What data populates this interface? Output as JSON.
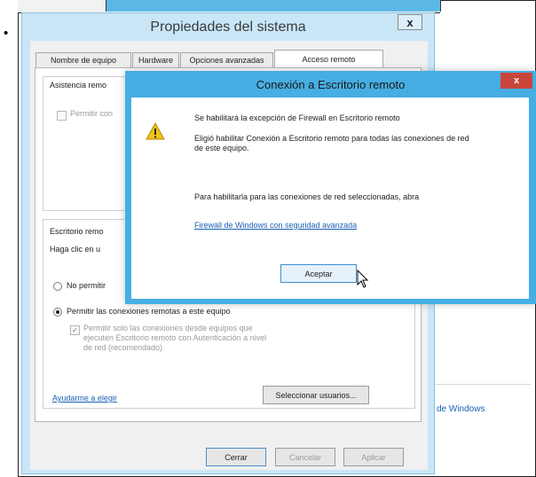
{
  "bullet": "•",
  "system_dialog": {
    "title": "Propiedades del sistema",
    "close": "x",
    "tabs": [
      {
        "label": "Nombre de equipo"
      },
      {
        "label": "Hardware"
      },
      {
        "label": "Opciones avanzadas"
      },
      {
        "label": "Acceso remoto",
        "active": true
      }
    ],
    "assistance_group": {
      "label": "Asistencia remo",
      "checkbox_label": "Permitir con",
      "checked": false
    },
    "remote_desktop_group": {
      "label": "Escritorio remo",
      "hint": "Haga clic en u",
      "options": [
        {
          "label": "No permitir",
          "selected": false
        },
        {
          "label": "Permitir las conexiones remotas a este equipo",
          "selected": true
        }
      ],
      "nla_label": "Permitir solo las conexiones desde equipos que ejecuten Escritorio remoto con Autenticación a nivel de red (recomendado)",
      "nla_checked": true
    },
    "help_link": "Ayudarme a elegir",
    "select_users_button": "Seleccionar usuarios...",
    "buttons": {
      "close": "Cerrar",
      "cancel": "Cancelar",
      "apply": "Aplicar"
    }
  },
  "popup": {
    "title": "Conexión a Escritorio remoto",
    "close": "x",
    "message1": "Se habilitará la excepción de Firewall en Escritorio remoto",
    "message2": "Eligió habilitar Conexión a Escritorio remoto para todas las conexiones de red de este equipo.",
    "message3": "Para habilitarla para las conexiones de red seleccionadas, abra",
    "link": "Firewall de Windows con seguridad avanzada",
    "ok_button": "Aceptar",
    "icon": "warning-icon"
  },
  "background_window": {
    "link_text": "de Windows"
  },
  "colors": {
    "dialog_frame": "#c9e6f7",
    "popup_frame": "#46aee3",
    "close_red": "#c9453b",
    "link": "#1a5fb4",
    "warning": "#f0c419"
  }
}
